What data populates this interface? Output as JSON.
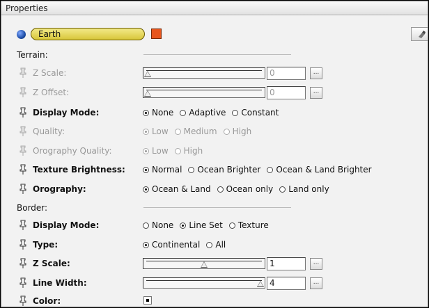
{
  "window": {
    "title": "Properties"
  },
  "header": {
    "name": "Earth",
    "swatch_color": "#e8561d",
    "globe_color": "#1f4fa8",
    "name_field_color": "#e6d85a"
  },
  "terrain": {
    "section_label": "Terrain:",
    "z_scale": {
      "label": "Z Scale:",
      "value": "0",
      "slider_fraction": 0.0,
      "button": "..."
    },
    "z_offset": {
      "label": "Z Offset:",
      "value": "0",
      "slider_fraction": 0.0,
      "button": "..."
    },
    "display_mode": {
      "label": "Display Mode:",
      "options": [
        "None",
        "Adaptive",
        "Constant"
      ],
      "selected": "None"
    },
    "quality": {
      "label": "Quality:",
      "options": [
        "Low",
        "Medium",
        "High"
      ],
      "selected": "Low"
    },
    "orography_quality": {
      "label": "Orography Quality:",
      "options": [
        "Low",
        "High"
      ],
      "selected": "Low"
    },
    "texture_brightness": {
      "label": "Texture Brightness:",
      "options": [
        "Normal",
        "Ocean Brighter",
        "Ocean & Land Brighter"
      ],
      "selected": "Normal"
    },
    "orography": {
      "label": "Orography:",
      "options": [
        "Ocean & Land",
        "Ocean only",
        "Land only"
      ],
      "selected": "Ocean & Land"
    }
  },
  "border": {
    "section_label": "Border:",
    "display_mode": {
      "label": "Display Mode:",
      "options": [
        "None",
        "Line Set",
        "Texture"
      ],
      "selected": "Line Set"
    },
    "type": {
      "label": "Type:",
      "options": [
        "Continental",
        "All"
      ],
      "selected": "Continental"
    },
    "z_scale": {
      "label": "Z Scale:",
      "value": "1",
      "slider_fraction": 0.5,
      "button": "..."
    },
    "line_width": {
      "label": "Line Width:",
      "value": "4",
      "slider_fraction": 1.0,
      "button": "..."
    },
    "color": {
      "label": "Color:"
    }
  }
}
